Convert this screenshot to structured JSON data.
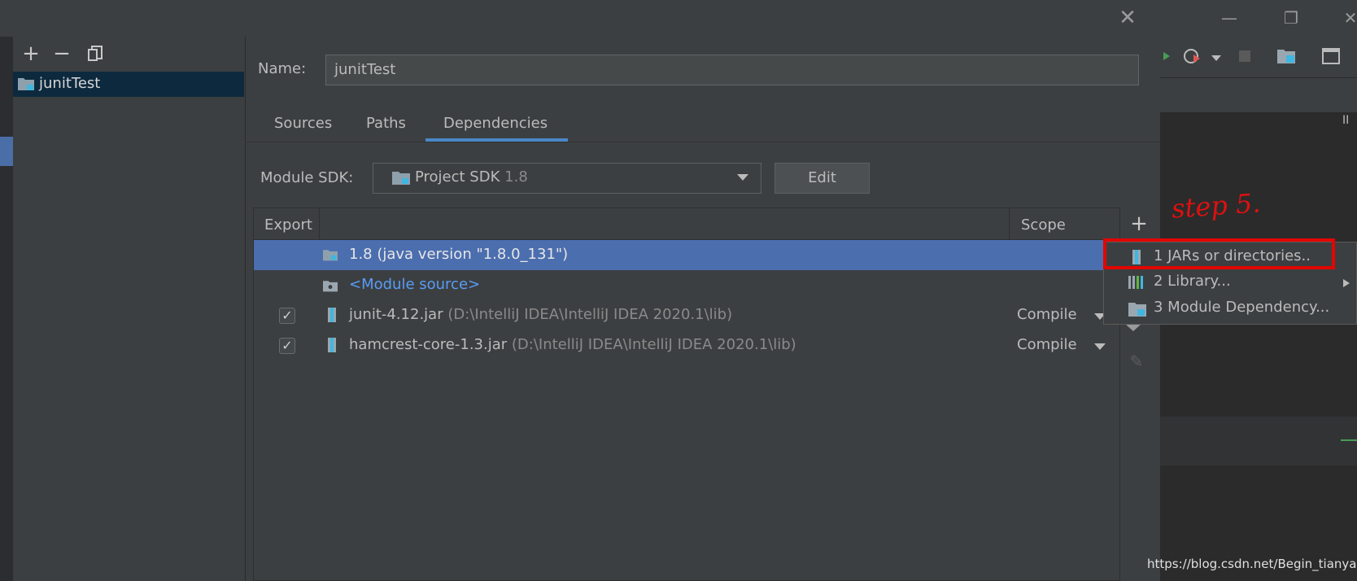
{
  "dialog": {
    "close_icon": "close-icon",
    "module_tools": {
      "add": "+",
      "remove": "−",
      "copy_icon": "copy-icon"
    },
    "modules": [
      {
        "name": "junitTest",
        "icon": "module-folder-icon"
      }
    ]
  },
  "module": {
    "name_label": "Name:",
    "name_value": "junitTest",
    "tabs": [
      {
        "label": "Sources",
        "active": false
      },
      {
        "label": "Paths",
        "active": false
      },
      {
        "label": "Dependencies",
        "active": true
      }
    ],
    "sdk_label": "Module SDK:",
    "sdk_value": "Project SDK",
    "sdk_version": "1.8",
    "edit_label": "Edit"
  },
  "dependencies": {
    "headers": {
      "export": "Export",
      "scope": "Scope"
    },
    "rows": [
      {
        "checked": null,
        "name": "1.8 (java version \"1.8.0_131\")",
        "path": "",
        "scope": "",
        "selected": true,
        "icon": "jdk-folder-icon"
      },
      {
        "checked": null,
        "name": "<Module source>",
        "path": "",
        "scope": "",
        "selected": false,
        "icon": "module-source-icon",
        "color": "#589df6"
      },
      {
        "checked": true,
        "name": "junit-4.12.jar",
        "path": "(D:\\IntelliJ IDEA\\IntelliJ IDEA 2020.1\\lib)",
        "scope": "Compile",
        "selected": false,
        "icon": "jar-icon"
      },
      {
        "checked": true,
        "name": "hamcrest-core-1.3.jar",
        "path": "(D:\\IntelliJ IDEA\\IntelliJ IDEA 2020.1\\lib)",
        "scope": "Compile",
        "selected": false,
        "icon": "jar-icon"
      }
    ],
    "add_button": "+"
  },
  "popup_menu": {
    "items": [
      {
        "label": "1  JARs or directories..",
        "icon": "jar-icon",
        "has_submenu": false
      },
      {
        "label": "2  Library...",
        "icon": "library-icon",
        "has_submenu": true
      },
      {
        "label": "3  Module Dependency...",
        "icon": "module-icon",
        "has_submenu": false
      }
    ]
  },
  "annotation": {
    "step_text": "step 5.",
    "color": "#e10600"
  },
  "ide": {
    "minimize": "—",
    "restore": "❐",
    "close": "✕",
    "pause": "II"
  },
  "watermark": "https://blog.csdn.net/Begin_tianyan",
  "colors": {
    "selection": "#4b6eaf",
    "accent": "#4a88c7",
    "link": "#589df6"
  }
}
